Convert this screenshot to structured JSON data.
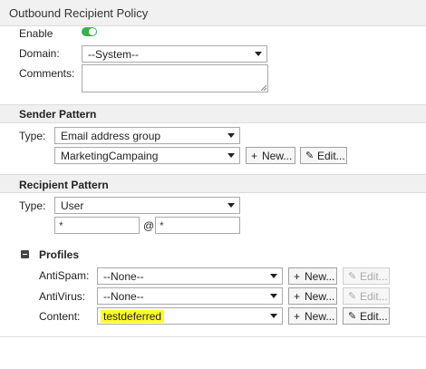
{
  "window": {
    "title": "Outbound Recipient Policy"
  },
  "general": {
    "enable_label": "Enable",
    "enable_on": true,
    "domain_label": "Domain:",
    "domain_value": "--System--",
    "comments_label": "Comments:",
    "comments_value": ""
  },
  "sender": {
    "section_title": "Sender Pattern",
    "type_label": "Type:",
    "type_value": "Email address group",
    "group_value": "MarketingCampaing",
    "new_label": "New...",
    "edit_label": "Edit..."
  },
  "recipient": {
    "section_title": "Recipient Pattern",
    "type_label": "Type:",
    "type_value": "User",
    "local_value": "*",
    "at_symbol": "@",
    "domain_value": "*"
  },
  "profiles": {
    "section_title": "Profiles",
    "rows": [
      {
        "label": "AntiSpam:",
        "value": "--None--",
        "new_label": "New...",
        "edit_label": "Edit...",
        "edit_enabled": false
      },
      {
        "label": "AntiVirus:",
        "value": "--None--",
        "new_label": "New...",
        "edit_label": "Edit...",
        "edit_enabled": false
      },
      {
        "label": "Content:",
        "value": "testdeferred",
        "new_label": "New...",
        "edit_label": "Edit...",
        "edit_enabled": true
      }
    ]
  },
  "colors": {
    "toggle_on": "#3fae49",
    "highlight": "#fffb2a",
    "section_bg": "#f0f0f0"
  }
}
